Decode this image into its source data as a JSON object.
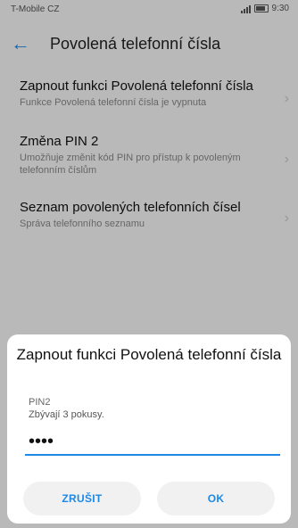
{
  "status": {
    "carrier": "T-Mobile CZ",
    "time": "9:30"
  },
  "appbar": {
    "back_icon": "arrow-left-icon",
    "title": "Povolená telefonní čísla"
  },
  "list": {
    "items": [
      {
        "title": "Zapnout funkci Povolená telefonní čísla",
        "subtitle": "Funkce Povolená telefonní čísla je vypnuta"
      },
      {
        "title": "Změna PIN 2",
        "subtitle": "Umožňuje změnit kód PIN pro přístup k povoleným telefonním číslům"
      },
      {
        "title": "Seznam povolených telefonních čísel",
        "subtitle": "Správa telefonního seznamu"
      }
    ]
  },
  "dialog": {
    "title": "Zapnout funkci Povolená telefonní čísla",
    "field_label": "PIN2",
    "attempts_text": "Zbývají 3 pokusy.",
    "pin_value": "••••",
    "cancel_label": "ZRUŠIT",
    "ok_label": "OK"
  },
  "colors": {
    "accent": "#1e88e5"
  }
}
